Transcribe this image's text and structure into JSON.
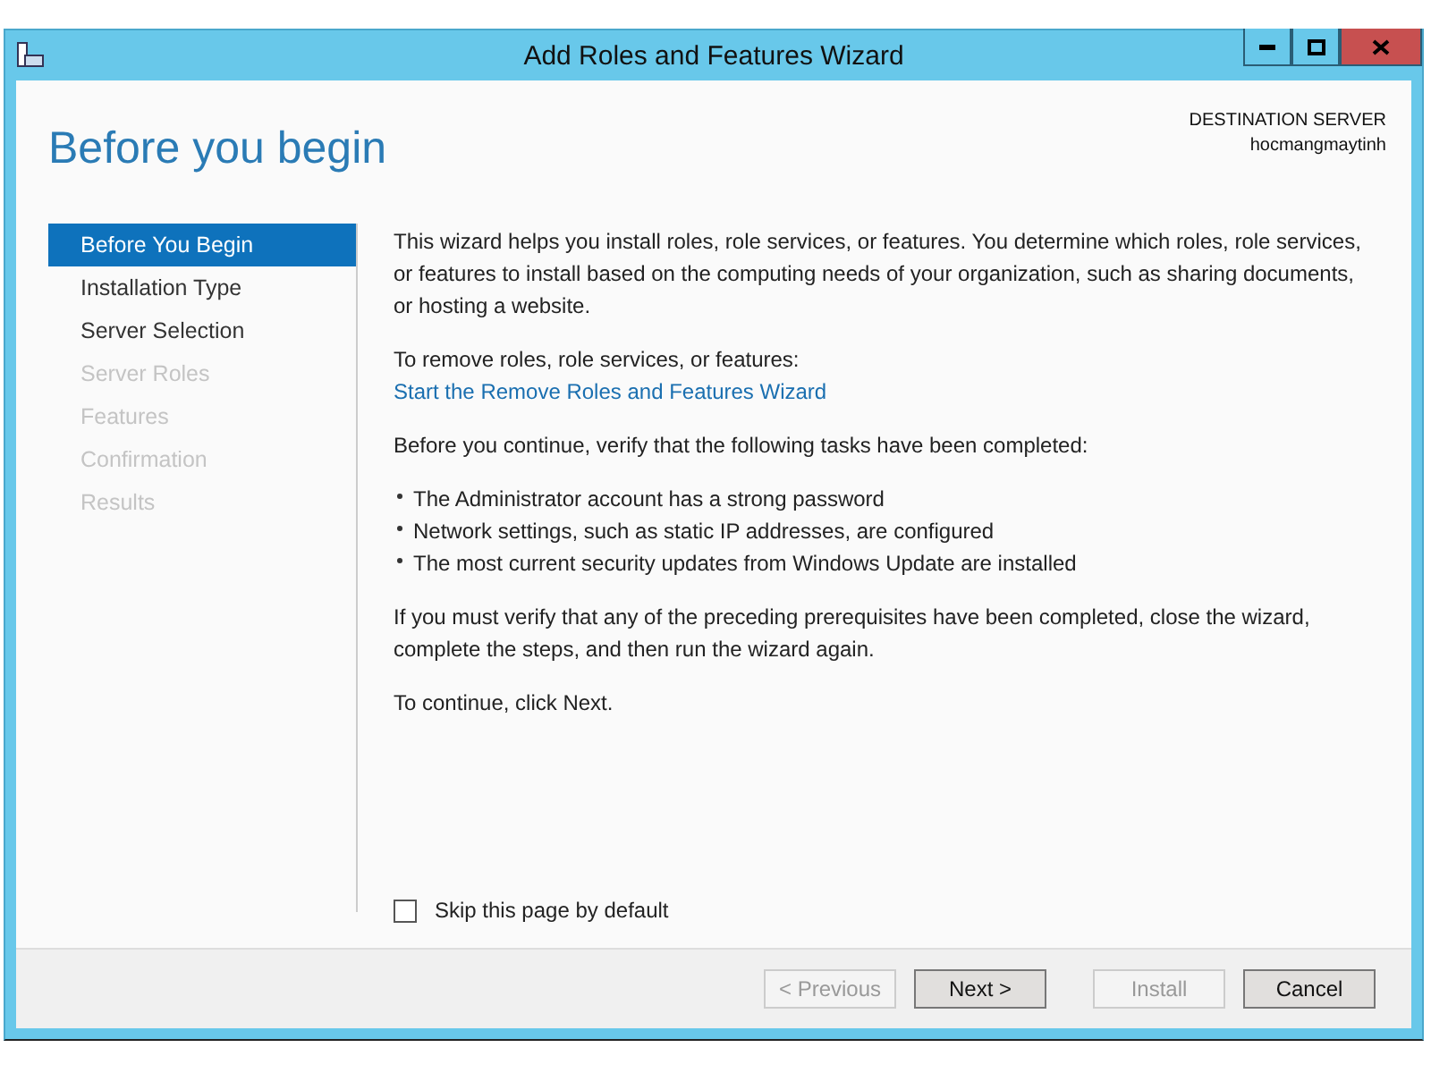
{
  "window": {
    "title": "Add Roles and Features Wizard"
  },
  "header": {
    "title": "Before you begin",
    "server_label": "DESTINATION SERVER",
    "server_name": "hocmangmaytinh"
  },
  "steps": [
    {
      "label": "Before You Begin",
      "selected": true,
      "disabled": false
    },
    {
      "label": "Installation Type",
      "selected": false,
      "disabled": false
    },
    {
      "label": "Server Selection",
      "selected": false,
      "disabled": false
    },
    {
      "label": "Server Roles",
      "selected": false,
      "disabled": true
    },
    {
      "label": "Features",
      "selected": false,
      "disabled": true
    },
    {
      "label": "Confirmation",
      "selected": false,
      "disabled": true
    },
    {
      "label": "Results",
      "selected": false,
      "disabled": true
    }
  ],
  "content": [
    {
      "kind": "paragraph",
      "text": "This wizard helps you install roles, role services, or features. You determine which roles, role services, or features to install based on the computing needs of your organization, such as sharing documents, or hosting a website."
    },
    {
      "kind": "paragraph",
      "text": "To remove roles, role services, or features:",
      "link": "Start the Remove Roles and Features Wizard"
    },
    {
      "kind": "paragraph",
      "text": "Before you continue, verify that the following tasks have been completed:"
    },
    {
      "kind": "bullets",
      "items": [
        "The Administrator account has a strong password",
        "Network settings, such as static IP addresses, are configured",
        "The most current security updates from Windows Update are installed"
      ]
    },
    {
      "kind": "paragraph",
      "text": "If you must verify that any of the preceding prerequisites have been completed, close the wizard, complete the steps, and then run the wizard again."
    },
    {
      "kind": "paragraph",
      "text": "To continue, click Next."
    }
  ],
  "skip_checkbox": {
    "label": "Skip this page by default",
    "checked": false
  },
  "buttons": [
    {
      "label": "< Previous",
      "disabled": true
    },
    {
      "label": "Next >",
      "disabled": false
    },
    {
      "label": "Install",
      "disabled": true
    },
    {
      "label": "Cancel",
      "disabled": false
    }
  ]
}
